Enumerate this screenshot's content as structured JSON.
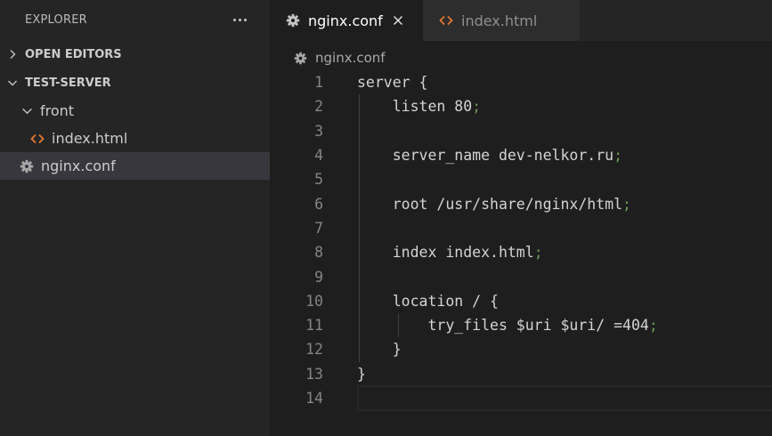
{
  "sidebar": {
    "title": "EXPLORER",
    "sections": [
      {
        "label": "OPEN EDITORS",
        "expanded": false
      },
      {
        "label": "TEST-SERVER",
        "expanded": true
      }
    ],
    "tree": [
      {
        "label": "front",
        "type": "folder",
        "icon": "chevron-down-icon"
      },
      {
        "label": "index.html",
        "type": "file",
        "icon": "html-file-icon"
      },
      {
        "label": "nginx.conf",
        "type": "file",
        "icon": "gear-icon",
        "selected": true
      }
    ]
  },
  "tabs": [
    {
      "label": "nginx.conf",
      "icon": "gear-icon",
      "active": true
    },
    {
      "label": "index.html",
      "icon": "html-file-icon",
      "active": false
    }
  ],
  "breadcrumb": {
    "label": "nginx.conf",
    "icon": "gear-icon"
  },
  "code": {
    "lines": [
      {
        "n": "1",
        "text": "server {",
        "semi": ""
      },
      {
        "n": "2",
        "text": "    listen 80",
        "semi": ";"
      },
      {
        "n": "3",
        "text": "",
        "semi": ""
      },
      {
        "n": "4",
        "text": "    server_name dev-nelkor.ru",
        "semi": ";"
      },
      {
        "n": "5",
        "text": "",
        "semi": ""
      },
      {
        "n": "6",
        "text": "    root /usr/share/nginx/html",
        "semi": ";"
      },
      {
        "n": "7",
        "text": "",
        "semi": ""
      },
      {
        "n": "8",
        "text": "    index index.html",
        "semi": ";"
      },
      {
        "n": "9",
        "text": "",
        "semi": ""
      },
      {
        "n": "10",
        "text": "    location / {",
        "semi": ""
      },
      {
        "n": "11",
        "text": "        try_files $uri $uri/ =404",
        "semi": ";"
      },
      {
        "n": "12",
        "text": "    }",
        "semi": ""
      },
      {
        "n": "13",
        "text": "}",
        "semi": ""
      },
      {
        "n": "14",
        "text": "",
        "semi": ""
      }
    ]
  },
  "colors": {
    "html_icon": "#e37933",
    "gear_icon": "#a8a8a8",
    "semicolon": "#6a9955",
    "line_number": "#858585"
  }
}
